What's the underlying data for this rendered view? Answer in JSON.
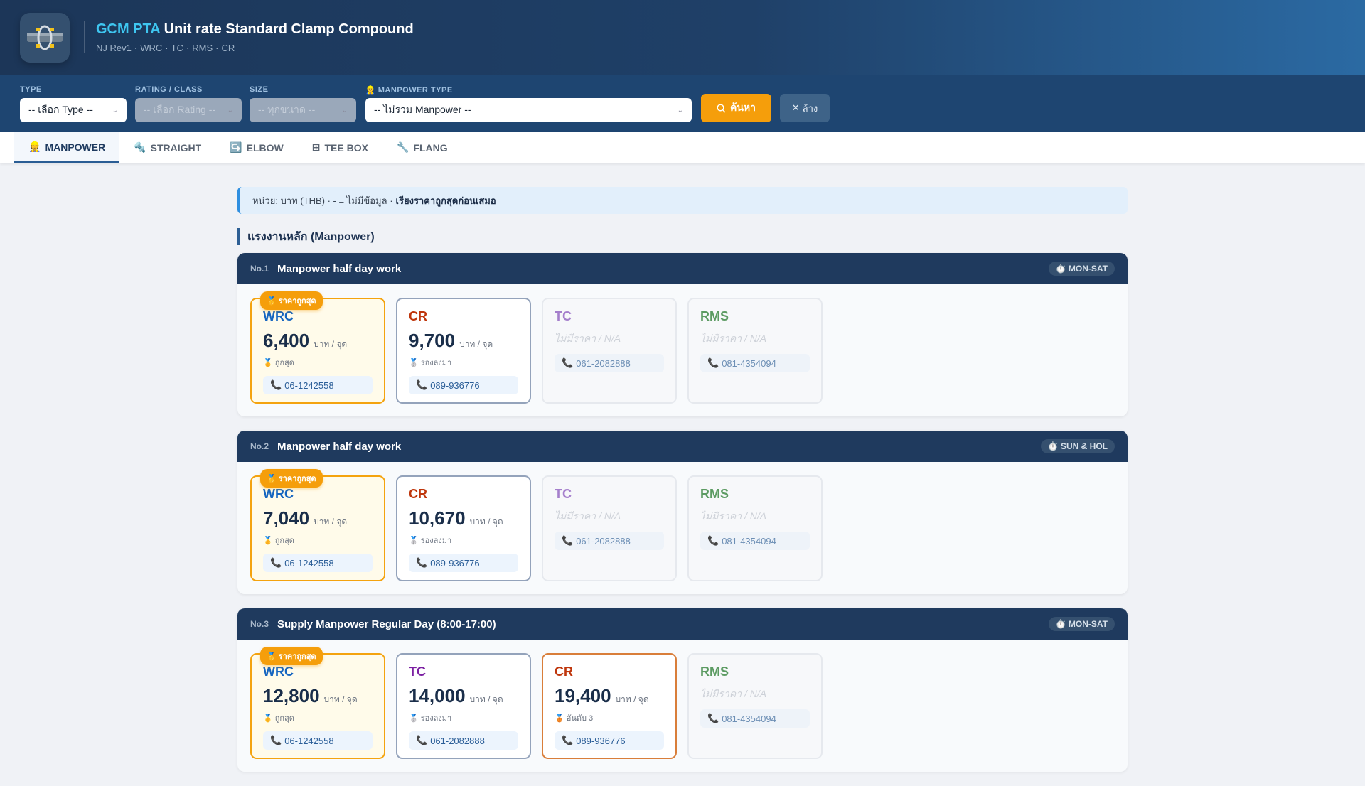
{
  "header": {
    "title_accent": "GCM PTA",
    "title_rest": "Unit rate Standard Clamp Compound",
    "subtitle": [
      "NJ Rev1",
      "·",
      "WRC",
      "·",
      "TC",
      "·",
      "RMS",
      "·",
      "CR"
    ]
  },
  "filters": {
    "type": {
      "label": "TYPE",
      "value": "-- เลือก Type --"
    },
    "rating": {
      "label": "RATING / CLASS",
      "value": "-- เลือก Rating --"
    },
    "size": {
      "label": "SIZE",
      "value": "-- ทุกขนาด --"
    },
    "manpower": {
      "label": "MANPOWER TYPE",
      "icon": "👷",
      "value": "-- ไม่รวม Manpower --"
    },
    "search_label": "ค้นหา",
    "clear_label": "ล้าง"
  },
  "tabs": [
    {
      "icon": "👷",
      "label": "MANPOWER",
      "active": true
    },
    {
      "icon": "🔩",
      "label": "STRAIGHT"
    },
    {
      "icon": "↪️",
      "label": "ELBOW"
    },
    {
      "icon": "⊞",
      "label": "TEE BOX"
    },
    {
      "icon": "🔧",
      "label": "FLANG"
    }
  ],
  "info": {
    "text": "หน่วย: บาท (THB) · - = ไม่มีข้อมูล ·",
    "bold": "เรียงราคาถูกสุดก่อนเสมอ"
  },
  "section_title": "แรงงานหลัก (Manpower)",
  "colors": {
    "WRC": "#1565c0",
    "CR": "#bf360c",
    "TC": "#7b1fa2",
    "RMS": "#5c9b62",
    "TC_na": "#a57fcc",
    "best": "#f59e0b"
  },
  "labels": {
    "unit": "บาท / จุด",
    "best_badge": "🥇 ราคาถูกสุด",
    "na": "ไม่มีราคา / N/A"
  },
  "rows": [
    {
      "no": "No.1",
      "name": "Manpower half day work",
      "day": "⏱️ MON-SAT",
      "cards": [
        {
          "co": "WRC",
          "price": "6,400",
          "rank": "🥇 ถูกสุด",
          "phone": "06-1242558",
          "tier": "best"
        },
        {
          "co": "CR",
          "price": "9,700",
          "rank": "🥈 รองลงมา",
          "phone": "089-936776",
          "tier": "second"
        },
        {
          "co": "TC",
          "price": null,
          "phone": "061-2082888",
          "tier": "naC"
        },
        {
          "co": "RMS",
          "price": null,
          "phone": "081-4354094",
          "tier": "naC"
        }
      ]
    },
    {
      "no": "No.2",
      "name": "Manpower half day work",
      "day": "⏱️ SUN & HOL",
      "cards": [
        {
          "co": "WRC",
          "price": "7,040",
          "rank": "🥇 ถูกสุด",
          "phone": "06-1242558",
          "tier": "best"
        },
        {
          "co": "CR",
          "price": "10,670",
          "rank": "🥈 รองลงมา",
          "phone": "089-936776",
          "tier": "second"
        },
        {
          "co": "TC",
          "price": null,
          "phone": "061-2082888",
          "tier": "naC"
        },
        {
          "co": "RMS",
          "price": null,
          "phone": "081-4354094",
          "tier": "naC"
        }
      ]
    },
    {
      "no": "No.3",
      "name": "Supply Manpower Regular Day (8:00-17:00)",
      "day": "⏱️ MON-SAT",
      "cards": [
        {
          "co": "WRC",
          "price": "12,800",
          "rank": "🥇 ถูกสุด",
          "phone": "06-1242558",
          "tier": "best"
        },
        {
          "co": "TC",
          "price": "14,000",
          "rank": "🥈 รองลงมา",
          "phone": "061-2082888",
          "tier": "second"
        },
        {
          "co": "CR",
          "price": "19,400",
          "rank": "🥉 อันดับ 3",
          "phone": "089-936776",
          "tier": "third"
        },
        {
          "co": "RMS",
          "price": null,
          "phone": "081-4354094",
          "tier": "naC"
        }
      ]
    }
  ]
}
